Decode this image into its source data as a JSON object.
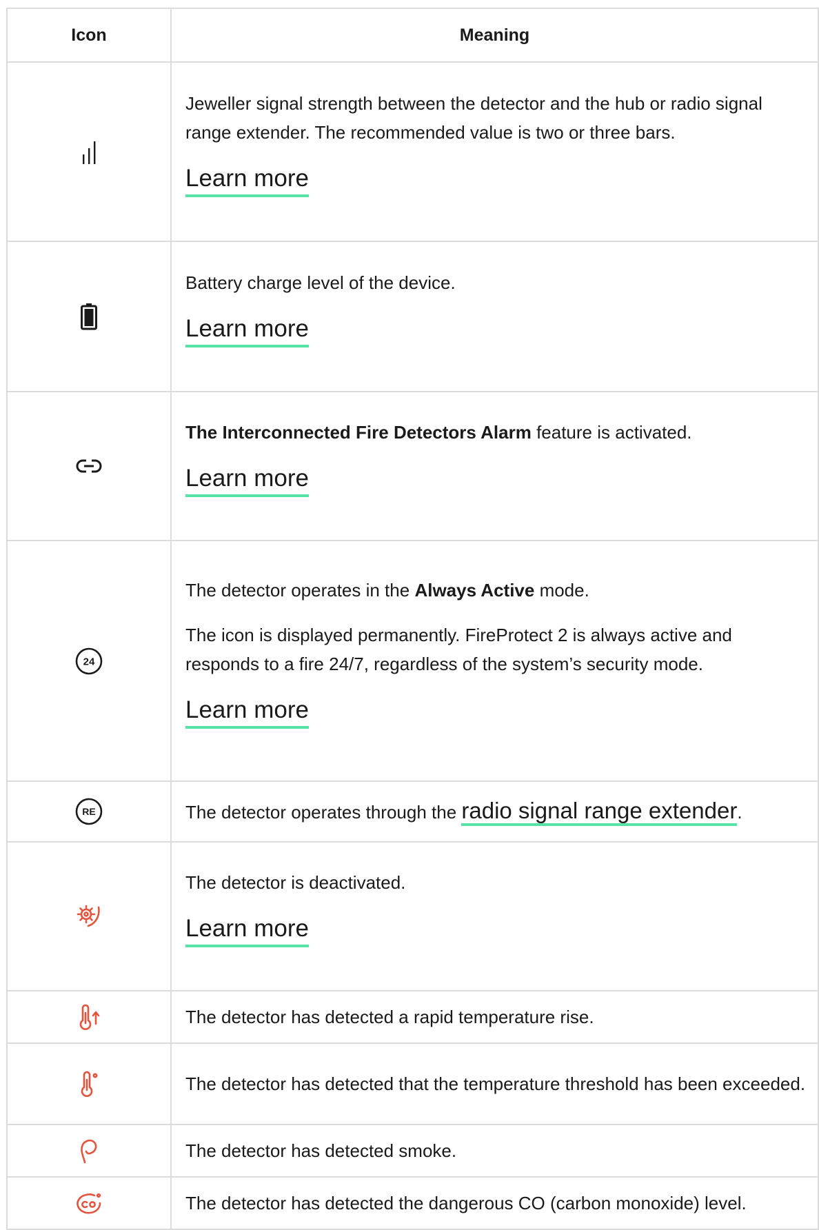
{
  "header": {
    "icon": "Icon",
    "meaning": "Meaning"
  },
  "colors": {
    "accent_underline": "#55e3a6",
    "alert_icon": "#e5533d",
    "neutral_icon": "#1a1a1a"
  },
  "rows": [
    {
      "icon": "signal-bars-icon",
      "text": "Jeweller signal strength between the detector and the hub or radio signal range extender. The recommended value is two or three bars.",
      "link": "Learn more"
    },
    {
      "icon": "battery-icon",
      "text": "Battery charge level of the device.",
      "link": "Learn more"
    },
    {
      "icon": "link-icon",
      "bold": "The Interconnected Fire Detectors Alarm",
      "text": " feature is activated.",
      "link": "Learn more"
    },
    {
      "icon": "always-active-24-icon",
      "pre": "The detector operates in the ",
      "bold": "Always Active",
      "post": " mode.",
      "text2": "The icon is displayed permanently. FireProtect 2 is always active and responds to a fire 24/7, regardless of the system’s security mode.",
      "link": "Learn more",
      "badge": "24"
    },
    {
      "icon": "range-extender-icon",
      "pre": "The detector operates through the ",
      "link": "radio signal range extender",
      "post": ".",
      "badge": "RE"
    },
    {
      "icon": "deactivated-gear-icon",
      "text": "The detector is deactivated.",
      "link": "Learn more"
    },
    {
      "icon": "rapid-temperature-rise-icon",
      "text": "The detector has detected a rapid temperature rise."
    },
    {
      "icon": "temperature-threshold-icon",
      "text": "The detector has detected that the temperature threshold has been exceeded."
    },
    {
      "icon": "smoke-icon",
      "text": "The detector has detected smoke."
    },
    {
      "icon": "co-icon",
      "text": "The detector has detected the dangerous CO (carbon monoxide) level."
    }
  ]
}
